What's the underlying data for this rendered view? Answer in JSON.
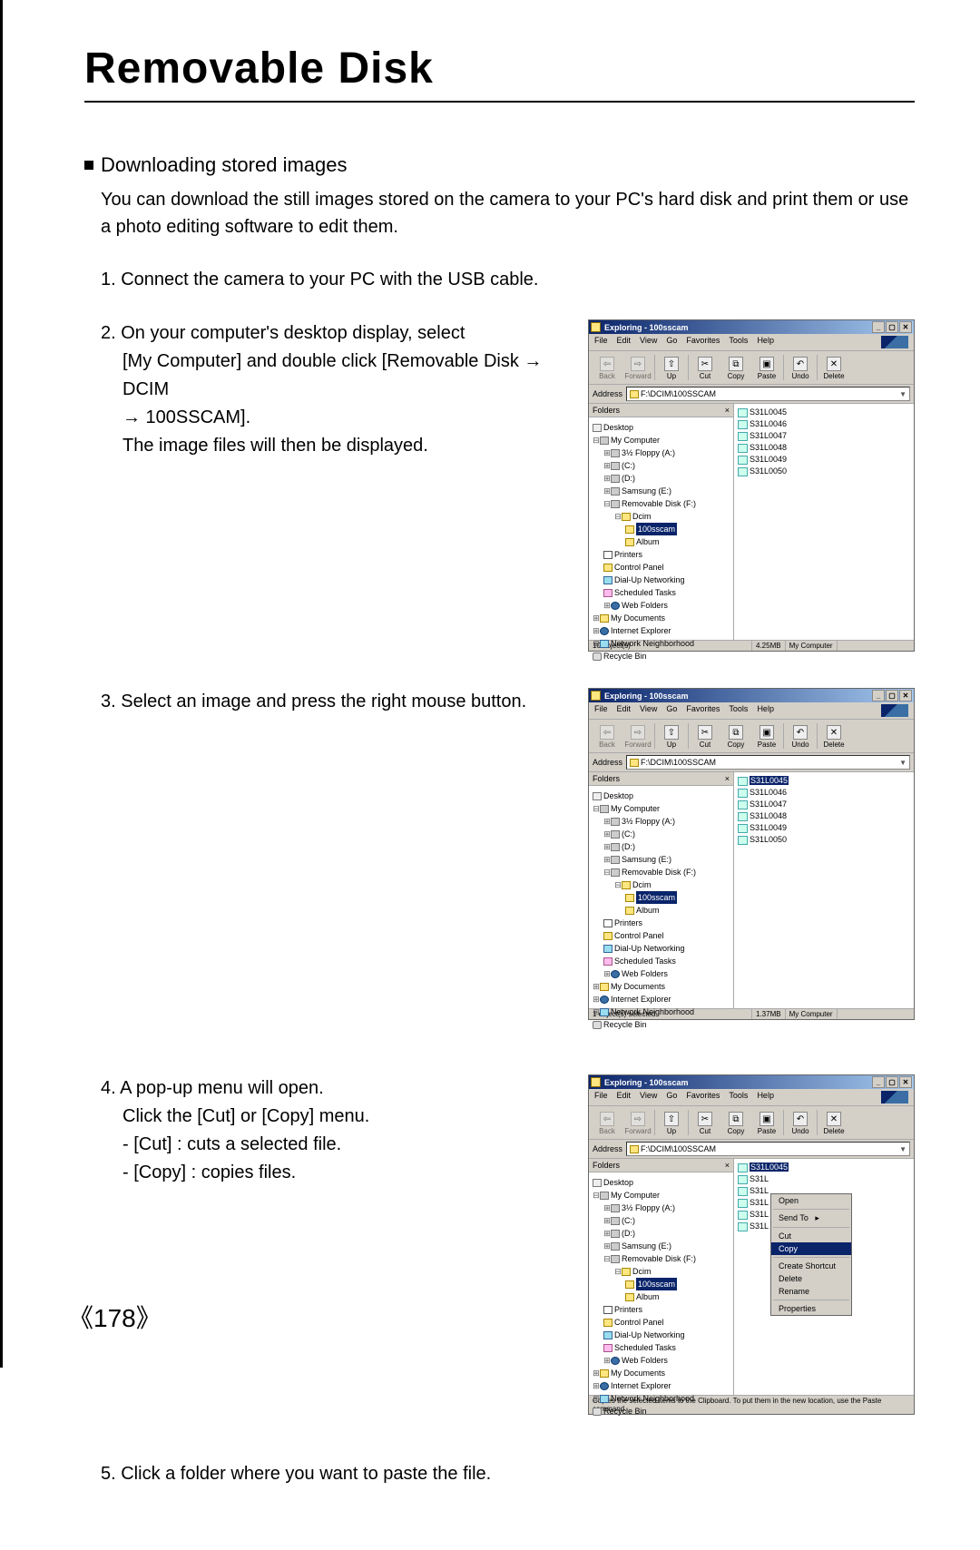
{
  "page_number": "《178》",
  "title": "Removable Disk",
  "section_heading": "Downloading stored images",
  "intro": "You can download the still images stored on the camera to your PC's hard disk and print them or use a photo editing software to edit them.",
  "steps": {
    "s1": "1. Connect the camera to your PC with the USB cable.",
    "s2": "2. On your computer's desktop display, select",
    "s2_sub1": "[My Computer] and double click [Removable Disk → DCIM",
    "s2_sub2": "→ 100SSCAM].",
    "s2_sub3": "The image files will then be displayed.",
    "s3": "3. Select an image and press the right mouse button.",
    "s4a": "4. A pop-up menu will open.",
    "s4b": "Click the [Cut] or [Copy] menu.",
    "s4_cut": "- [Cut]    : cuts a selected file.",
    "s4_copy": "- [Copy]  : copies files.",
    "s5": "5. Click a folder where you want to paste the file."
  },
  "explorer": {
    "title": "Exploring - 100sscam",
    "menus": [
      "File",
      "Edit",
      "View",
      "Go",
      "Favorites",
      "Tools",
      "Help"
    ],
    "toolbar": {
      "back": "Back",
      "forward": "Forward",
      "up": "Up",
      "cut": "Cut",
      "copy": "Copy",
      "paste": "Paste",
      "undo": "Undo",
      "delete": "Delete"
    },
    "address_label": "Address",
    "address_value": "F:\\DCIM\\100SSCAM",
    "folders_label": "Folders",
    "tree": {
      "desktop": "Desktop",
      "mycomputer": "My Computer",
      "floppy": "3½ Floppy (A:)",
      "c": "(C:)",
      "d": "(D:)",
      "samsung": "Samsung (E:)",
      "removable": "Removable Disk (F:)",
      "dcim": "Dcim",
      "sscam": "100sscam",
      "album": "Album",
      "printers": "Printers",
      "cpanel": "Control Panel",
      "dialup": "Dial-Up Networking",
      "sched": "Scheduled Tasks",
      "webf": "Web Folders",
      "mydocs": "My Documents",
      "ie": "Internet Explorer",
      "nn": "Network Neighborhood",
      "bin": "Recycle Bin"
    },
    "files": [
      "S31L0045",
      "S31L0046",
      "S31L0047",
      "S31L0048",
      "S31L0049",
      "S31L0050"
    ],
    "status1_left": "10 object(s)",
    "status1_mid": "4.25MB",
    "status1_right": "My Computer",
    "status2_left": "1 object(s) selected",
    "status2_mid": "1.37MB",
    "status3": "Copies the selected items to the Clipboard. To put them in the new location, use the Paste command.",
    "ctx": {
      "open": "Open",
      "sendto": "Send To",
      "cut": "Cut",
      "copy": "Copy",
      "shortcut": "Create Shortcut",
      "delete": "Delete",
      "rename": "Rename",
      "prop": "Properties"
    }
  }
}
